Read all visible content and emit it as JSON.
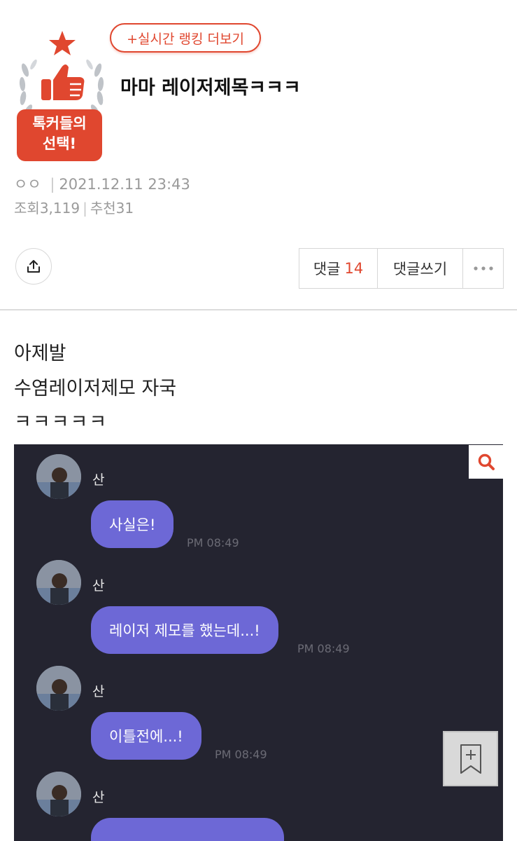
{
  "header": {
    "ranking_button": "+실시간 랭킹 더보기",
    "badge_text_line1": "톡커들의",
    "badge_text_line2": "선택!",
    "title": "마마 레이저제목ㅋㅋㅋ"
  },
  "meta": {
    "author": "ㅇㅇ",
    "date": "2021.12.11 23:43",
    "views_label": "조회",
    "views": "3,119",
    "recommend_label": "추천",
    "recommend": "31"
  },
  "actions": {
    "comments_label": "댓글",
    "comments_count": "14",
    "write_comment_label": "댓글쓰기",
    "more_label": "···"
  },
  "post_body": {
    "lines": [
      "아제발",
      "수염레이저제모 자국",
      "ㅋㅋㅋㅋㅋ"
    ]
  },
  "chat": {
    "messages": [
      {
        "sender": "산",
        "text": "사실은!",
        "time": "PM 08:49"
      },
      {
        "sender": "산",
        "text": "레이저 제모를 했는데...!",
        "time": "PM 08:49"
      },
      {
        "sender": "산",
        "text": "이틀전에...!",
        "time": "PM 08:49"
      },
      {
        "sender": "산",
        "text": "",
        "time": ""
      }
    ]
  },
  "icons": {
    "share": "share-icon",
    "search": "search-icon",
    "bookmark": "bookmark-add-icon",
    "more": "more-dots-icon",
    "badge": "thumbs-up-icon"
  },
  "colors": {
    "accent": "#e0472f",
    "chat_bg": "#242430",
    "bubble": "#6d68d6"
  }
}
